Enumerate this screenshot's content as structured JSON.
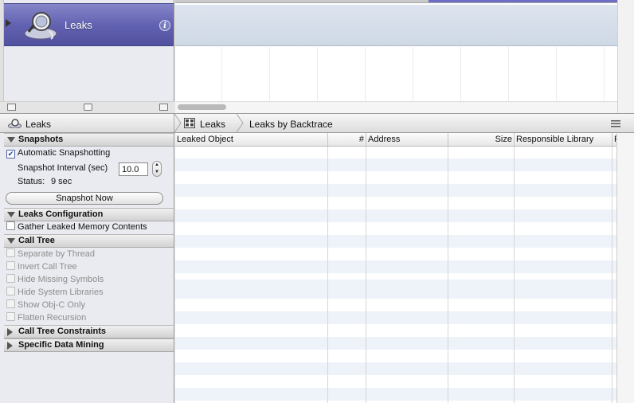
{
  "instrument": {
    "name": "Leaks",
    "info_symbol": "i"
  },
  "navbar": {
    "left_title": "Leaks",
    "crumb_view": "Leaks",
    "crumb_detail": "Leaks by Backtrace"
  },
  "panel": {
    "snapshots": {
      "header": "Snapshots",
      "auto_label": "Automatic Snapshotting",
      "auto_checked": true,
      "interval_label": "Snapshot Interval (sec)",
      "interval_value": "10.0",
      "status_label": "Status:",
      "status_value": "9 sec",
      "button": "Snapshot Now"
    },
    "leaks_config": {
      "header": "Leaks Configuration",
      "gather_label": "Gather Leaked Memory Contents"
    },
    "call_tree": {
      "header": "Call Tree",
      "options": [
        "Separate by Thread",
        "Invert Call Tree",
        "Hide Missing Symbols",
        "Hide System Libraries",
        "Show Obj-C Only",
        "Flatten Recursion"
      ]
    },
    "constraints": {
      "header": "Call Tree Constraints"
    },
    "data_mining": {
      "header": "Specific Data Mining"
    }
  },
  "table": {
    "columns": [
      "Leaked Object",
      "#",
      "Address",
      "Size",
      "Responsible Library",
      "R"
    ],
    "rows": []
  },
  "colors": {
    "instrument_row": "#6262b2",
    "stripe": "#eef2f9"
  }
}
